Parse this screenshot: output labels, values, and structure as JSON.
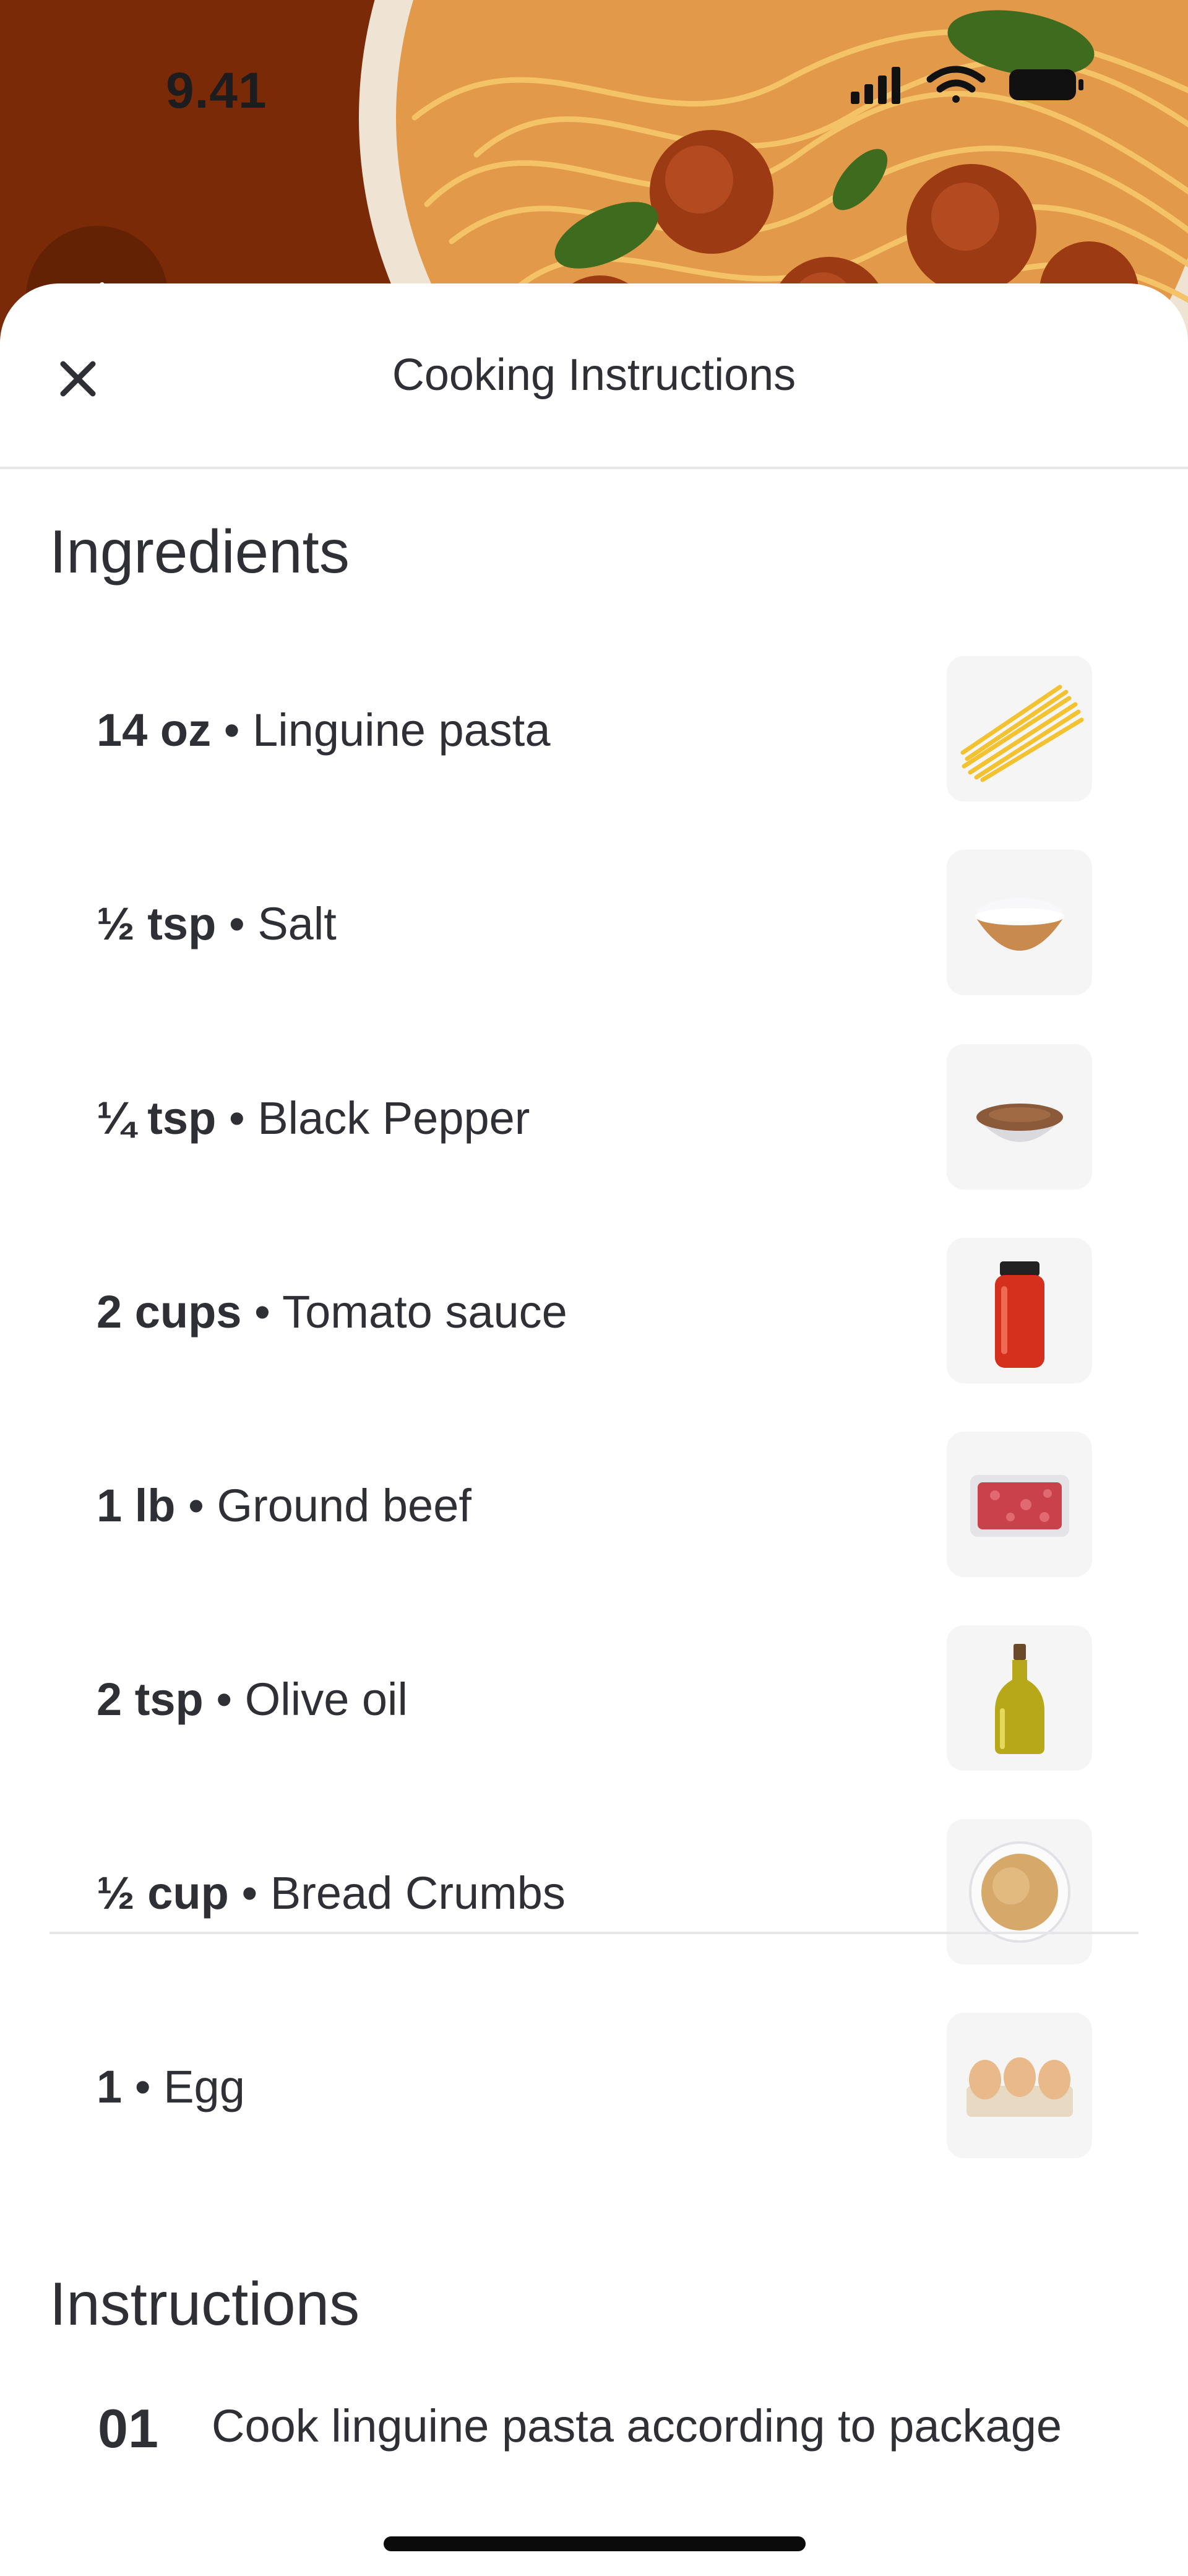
{
  "status_bar": {
    "time": "9.41"
  },
  "header": {
    "title": "Cooking Instructions"
  },
  "ingredients": {
    "title": "Ingredients",
    "items": [
      {
        "qty": "14 oz",
        "name": "Linguine pasta",
        "image": "linguine-pasta-photo"
      },
      {
        "qty": "½ tsp",
        "name": "Salt",
        "image": "salt-bowl-photo"
      },
      {
        "qty": "¼ tsp",
        "name": "Black Pepper",
        "image": "black-pepper-bowl-photo"
      },
      {
        "qty": "2 cups",
        "name": "Tomato sauce",
        "image": "tomato-sauce-jar-photo"
      },
      {
        "qty": "1 lb",
        "name": "Ground beef",
        "image": "ground-beef-tray-photo"
      },
      {
        "qty": "2 tsp",
        "name": "Olive oil",
        "image": "olive-oil-bottle-photo"
      },
      {
        "qty": "½ cup",
        "name": "Bread Crumbs",
        "image": "bread-crumbs-bowl-photo"
      },
      {
        "qty": "1",
        "name": "Egg",
        "image": "egg-carton-photo"
      }
    ]
  },
  "instructions": {
    "title": "Instructions",
    "steps": [
      {
        "number": "01",
        "text": "Cook linguine pasta according to package"
      }
    ]
  },
  "colors": {
    "hero_background": "#7a2a06",
    "text": "#2f2f36",
    "divider": "#e6e6e8"
  }
}
